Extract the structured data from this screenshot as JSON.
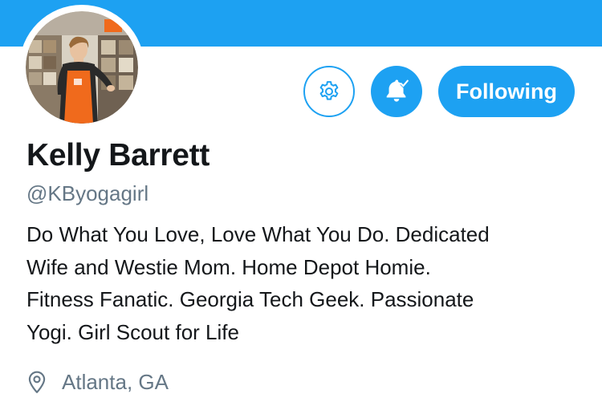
{
  "header": {
    "banner_color": "#1da1f2"
  },
  "profile": {
    "avatar_icon": "avatar-photo",
    "display_name": "Kelly Barrett",
    "handle": "@KByogagirl",
    "bio_lines": [
      "Do What You Love, Love What You Do. Dedicated",
      "Wife and Westie Mom. Home Depot Homie.",
      "Fitness Fanatic. Georgia Tech Geek. Passionate",
      "Yogi. Girl Scout for Life"
    ],
    "location": "Atlanta, GA",
    "location_icon": "map-pin-icon"
  },
  "actions": {
    "settings_icon": "gear-icon",
    "notifications_icon": "bell-check-icon",
    "following_label": "Following"
  },
  "colors": {
    "accent": "#1da1f2",
    "text_primary": "#14171a",
    "text_secondary": "#657786"
  }
}
